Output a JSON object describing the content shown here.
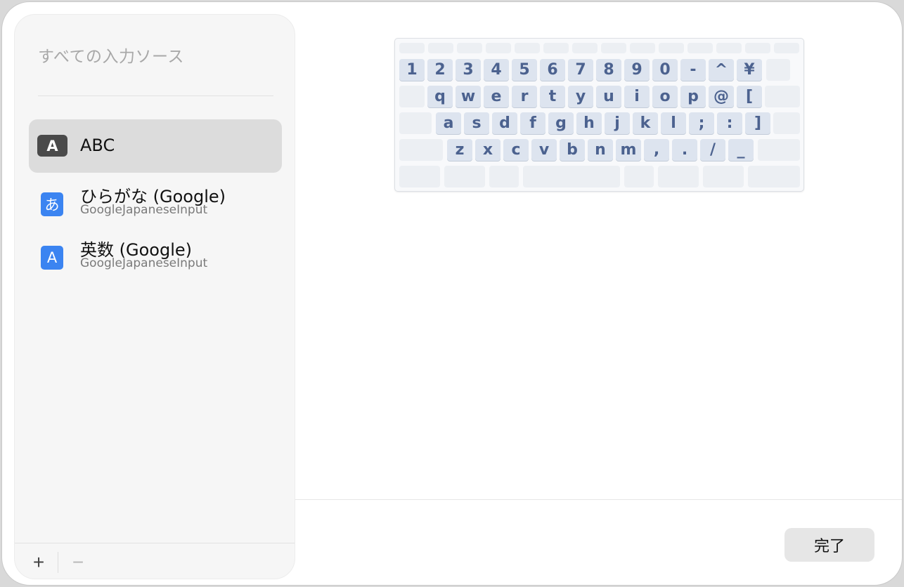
{
  "sidebar": {
    "title": "すべての入力ソース",
    "items": [
      {
        "icon_label": "A",
        "icon": "letter-a-icon",
        "name": "ABC",
        "subtitle": "",
        "selected": true
      },
      {
        "icon_label": "あ",
        "icon": "hiragana-a-icon",
        "name": "ひらがな (Google)",
        "subtitle": "GoogleJapaneseInput",
        "selected": false
      },
      {
        "icon_label": "A",
        "icon": "letter-a-icon",
        "name": "英数 (Google)",
        "subtitle": "GoogleJapaneseInput",
        "selected": false
      }
    ],
    "add_label": "+",
    "remove_label": "−"
  },
  "keyboard": {
    "rows": [
      [
        "1",
        "2",
        "3",
        "4",
        "5",
        "6",
        "7",
        "8",
        "9",
        "0",
        "-",
        "^",
        "¥"
      ],
      [
        "q",
        "w",
        "e",
        "r",
        "t",
        "y",
        "u",
        "i",
        "o",
        "p",
        "@",
        "["
      ],
      [
        "a",
        "s",
        "d",
        "f",
        "g",
        "h",
        "j",
        "k",
        "l",
        ";",
        ":",
        "]"
      ],
      [
        "z",
        "x",
        "c",
        "v",
        "b",
        "n",
        "m",
        ",",
        ".",
        "/",
        "_"
      ]
    ]
  },
  "footer": {
    "done_label": "完了"
  },
  "colors": {
    "key_fill": "#dde4ef",
    "key_text": "#4c628f",
    "icon_blue": "#3b84f1",
    "icon_dark": "#4a4a4a"
  }
}
